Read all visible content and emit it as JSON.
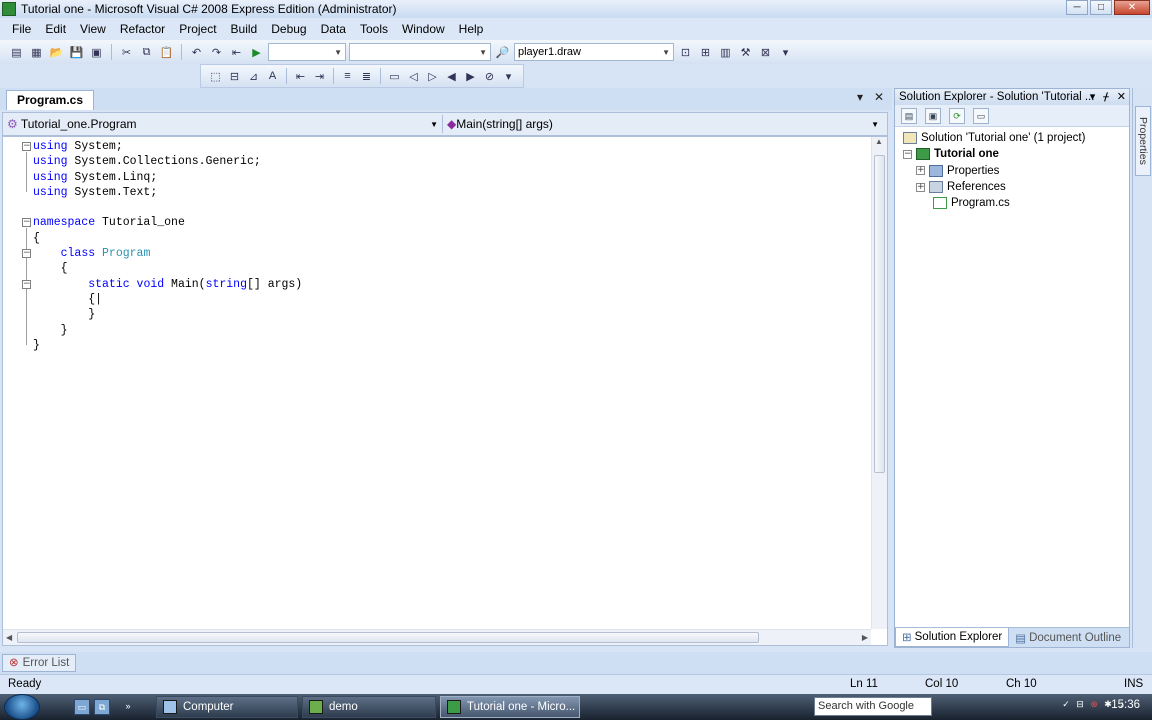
{
  "window": {
    "title": "Tutorial one - Microsoft Visual C# 2008 Express Edition (Administrator)",
    "controls": [
      "─",
      "□",
      "✕"
    ]
  },
  "menu": [
    "File",
    "Edit",
    "View",
    "Refactor",
    "Project",
    "Build",
    "Debug",
    "Data",
    "Tools",
    "Window",
    "Help"
  ],
  "toolbar": {
    "config_combo": "",
    "platform_combo": "",
    "find_combo": "player1.draw"
  },
  "document": {
    "tab_label": "Program.cs",
    "tab_controls": [
      "▾",
      "✕"
    ],
    "class_combo": "Tutorial_one.Program",
    "member_combo": "Main(string[] args)",
    "code_lines": [
      [
        {
          "t": "using",
          "c": "kw"
        },
        {
          "t": " System;"
        }
      ],
      [
        {
          "t": "using",
          "c": "kw"
        },
        {
          "t": " System.Collections.Generic;"
        }
      ],
      [
        {
          "t": "using",
          "c": "kw"
        },
        {
          "t": " System.Linq;"
        }
      ],
      [
        {
          "t": "using",
          "c": "kw"
        },
        {
          "t": " System.Text;"
        }
      ],
      [
        {
          "t": ""
        }
      ],
      [
        {
          "t": "namespace",
          "c": "kw"
        },
        {
          "t": " Tutorial_one"
        }
      ],
      [
        {
          "t": "{"
        }
      ],
      [
        {
          "t": "    "
        },
        {
          "t": "class",
          "c": "kw"
        },
        {
          "t": " "
        },
        {
          "t": "Program",
          "c": "type"
        }
      ],
      [
        {
          "t": "    {"
        }
      ],
      [
        {
          "t": "        "
        },
        {
          "t": "static",
          "c": "kw"
        },
        {
          "t": " "
        },
        {
          "t": "void",
          "c": "kw"
        },
        {
          "t": " Main("
        },
        {
          "t": "string",
          "c": "kw"
        },
        {
          "t": "[] args)"
        }
      ],
      [
        {
          "t": "        {|"
        }
      ],
      [
        {
          "t": "        }"
        }
      ],
      [
        {
          "t": "    }"
        }
      ],
      [
        {
          "t": "}"
        }
      ]
    ]
  },
  "solution_explorer": {
    "title": "Solution Explorer - Solution 'Tutorial ...",
    "title_controls": [
      "▾",
      "ᚋ",
      "✕"
    ],
    "solution": "Solution 'Tutorial one' (1 project)",
    "project": "Tutorial one",
    "items": [
      "Properties",
      "References",
      "Program.cs"
    ],
    "tabs": [
      "Solution Explorer",
      "Document Outline"
    ]
  },
  "properties_tab": "Properties",
  "error_list_tab": "Error List",
  "status": {
    "text": "Ready",
    "line": "Ln 11",
    "col": "Col 10",
    "ch": "Ch 10",
    "mode": "INS"
  },
  "taskbar": {
    "buttons": [
      "Computer",
      "demo",
      "Tutorial one - Micro..."
    ],
    "search_placeholder": "Search with Google",
    "clock": "15:36"
  }
}
